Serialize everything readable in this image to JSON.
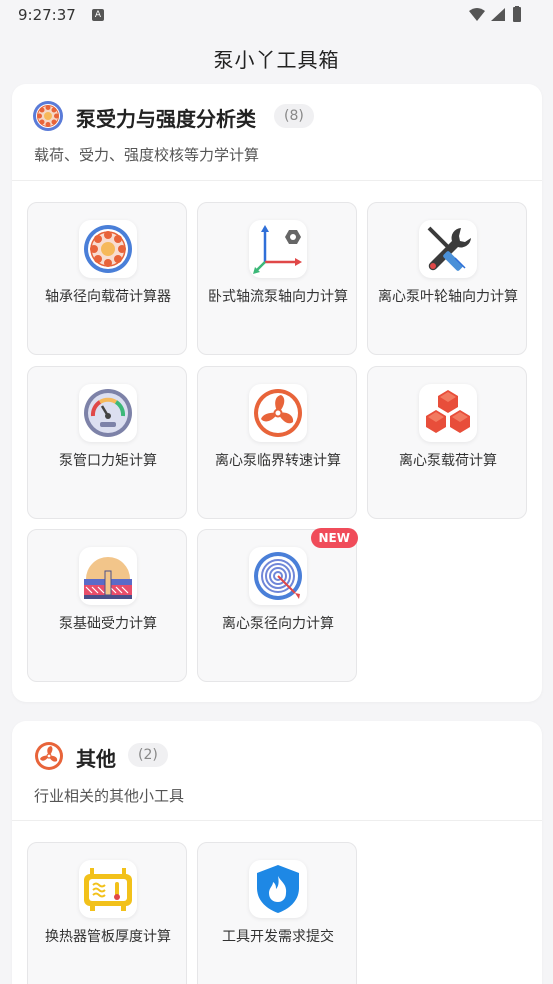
{
  "status": {
    "time": "9:27:37",
    "notification_letter": "A"
  },
  "app": {
    "title": "泵小丫工具箱"
  },
  "categories": [
    {
      "title": "泵受力与强度分析类",
      "count": "(8)",
      "description": "载荷、受力、强度校核等力学计算",
      "tools": [
        {
          "label": "轴承径向载荷计算器",
          "icon": "bearing-icon"
        },
        {
          "label": "卧式轴流泵轴向力计算",
          "icon": "axis-hexagon-icon"
        },
        {
          "label": "离心泵叶轮轴向力计算",
          "icon": "wrench-screwdriver-icon"
        },
        {
          "label": "泵管口力矩计算",
          "icon": "gauge-icon"
        },
        {
          "label": "离心泵临界转速计算",
          "icon": "fan-icon"
        },
        {
          "label": "离心泵载荷计算",
          "icon": "cubes-icon"
        },
        {
          "label": "泵基础受力计算",
          "icon": "foundation-icon"
        },
        {
          "label": "离心泵径向力计算",
          "icon": "target-icon",
          "badge": "NEW"
        }
      ]
    },
    {
      "title": "其他",
      "count": "(2)",
      "description": "行业相关的其他小工具",
      "tools": [
        {
          "label": "换热器管板厚度计算",
          "icon": "heater-icon"
        },
        {
          "label": "工具开发需求提交",
          "icon": "shield-fire-icon"
        }
      ]
    }
  ],
  "colors": {
    "accent_red": "#f04c5a",
    "icon_orange": "#e8643a",
    "icon_blue": "#4a7fd8"
  }
}
